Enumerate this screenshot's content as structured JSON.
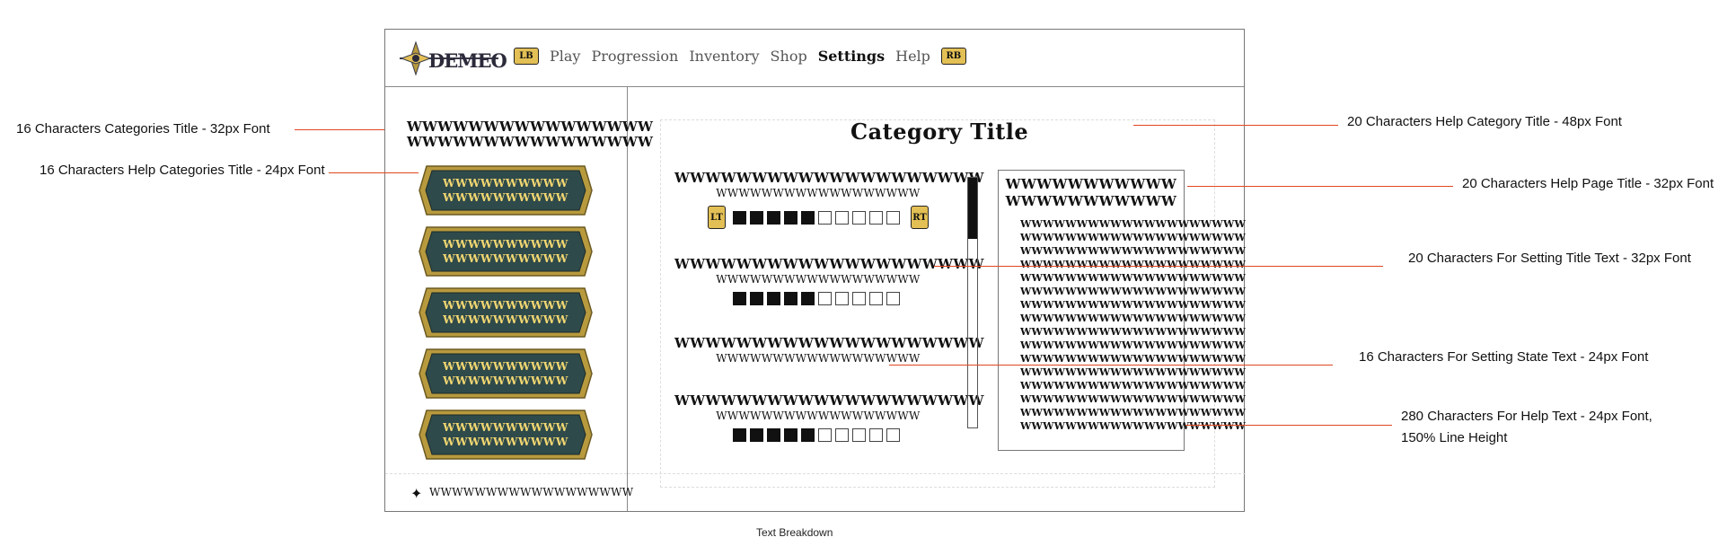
{
  "app": {
    "logo_text": "DEMEO"
  },
  "nav": {
    "lb": "LB",
    "rb": "RB",
    "items": [
      {
        "label": "Play",
        "active": false
      },
      {
        "label": "Progression",
        "active": false
      },
      {
        "label": "Inventory",
        "active": false
      },
      {
        "label": "Shop",
        "active": false
      },
      {
        "label": "Settings",
        "active": true
      },
      {
        "label": "Help",
        "active": false
      }
    ]
  },
  "sidebar": {
    "title_line1": "WWWWWWWWWWWWWWWW",
    "title_line2": "WWWWWWWWWWWWWWWW",
    "buttons": [
      {
        "line1": "WWWWWWWWWW",
        "line2": "WWWWWWWWWW"
      },
      {
        "line1": "WWWWWWWWWW",
        "line2": "WWWWWWWWWW"
      },
      {
        "line1": "WWWWWWWWWW",
        "line2": "WWWWWWWWWW"
      },
      {
        "line1": "WWWWWWWWWW",
        "line2": "WWWWWWWWWW"
      },
      {
        "line1": "WWWWWWWWWW",
        "line2": "WWWWWWWWWW"
      }
    ],
    "footer_text": "WWWWWWWWWWWWWWWWWW"
  },
  "main": {
    "category_title": "Category Title",
    "lt": "LT",
    "rt": "RT",
    "settings": [
      {
        "title": "WWWWWWWWWWWWWWWWWWWW",
        "state": "WWWWWWWWWWWWWWWWWW",
        "slider": true,
        "filled": 5,
        "total": 10,
        "triggers": true
      },
      {
        "title": "WWWWWWWWWWWWWWWWWWWW",
        "state": "WWWWWWWWWWWWWWWWWW",
        "slider": true,
        "filled": 5,
        "total": 10,
        "triggers": false
      },
      {
        "title": "WWWWWWWWWWWWWWWWWWWW",
        "state": "WWWWWWWWWWWWWWWWWW",
        "slider": false
      },
      {
        "title": "WWWWWWWWWWWWWWWWWWWW",
        "state": "WWWWWWWWWWWWWWWWWW",
        "slider": true,
        "filled": 5,
        "total": 10,
        "triggers": false
      }
    ],
    "help": {
      "title_line1": "WWWWWWWWWWW",
      "title_line2": "WWWWWWWWWWW",
      "lines": [
        "WWWWWWWWWWWWWWWWWWWW",
        "WWWWWWWWWWWWWWWWWWWW",
        "WWWWWWWWWWWWWWWWWWWW",
        "WWWWWWWWWWWWWWWWWWWW",
        "WWWWWWWWWWWWWWWWWWWW",
        "WWWWWWWWWWWWWWWWWWWW",
        "WWWWWWWWWWWWWWWWWWWW",
        "WWWWWWWWWWWWWWWWWWWW",
        "WWWWWWWWWWWWWWWWWWWW",
        "WWWWWWWWWWWWWWWWWWWW",
        "WWWWWWWWWWWWWWWWWWWW",
        "WWWWWWWWWWWWWWWWWWWW",
        "WWWWWWWWWWWWWWWWWWWW",
        "WWWWWWWWWWWWWWWWWWWW",
        "WWWWWWWWWWWWWWWWWWWW",
        "WWWWWWWWWWWWWWWWWWWW"
      ]
    }
  },
  "annotations": {
    "cat_title": "16 Characters Categories Title - 32px Font",
    "help_cat_title": "16 Characters Help Categories Title - 24px Font",
    "help_category_title": "20 Characters Help Category Title - 48px Font",
    "help_page_title": "20 Characters Help Page Title - 32px Font",
    "setting_title": "20 Characters For Setting Title Text - 32px Font",
    "setting_state": "16 Characters For Setting State Text - 24px Font",
    "help_text": "280 Characters For Help Text - 24px Font, 150% Line Height"
  },
  "caption": "Text Breakdown",
  "colors": {
    "accent_line": "#e0471f",
    "badge": "#e3c055",
    "button_fill": "#2f4a4a",
    "button_frame": "#b89a3e",
    "button_text": "#f2d772"
  }
}
